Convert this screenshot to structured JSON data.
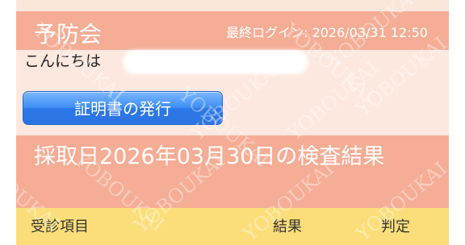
{
  "header": {
    "app_title": "予防会",
    "last_login": "最終ログイン: 2026/03/31 12:50"
  },
  "user": {
    "greeting": "こんにちは"
  },
  "actions": {
    "certificate_button": "証明書の発行"
  },
  "results": {
    "title": "採取日2026年03月30日の検査結果",
    "columns": [
      "受診項目",
      "結果",
      "判定"
    ]
  },
  "watermark": {
    "text": "YOBOUKAI"
  },
  "colors": {
    "header_salmon": "#f5ad95",
    "pale_pink": "#fde8df",
    "button_blue": "#2c78e8",
    "table_yellow": "#fbde7a"
  }
}
